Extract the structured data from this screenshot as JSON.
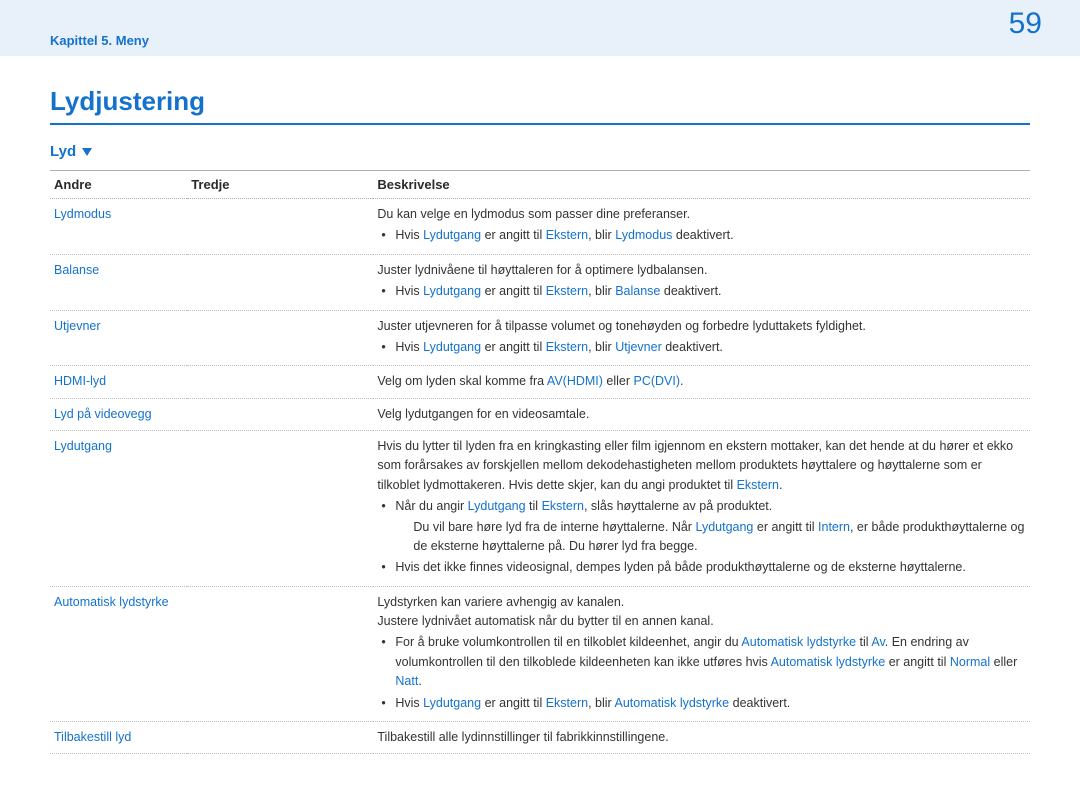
{
  "header": {
    "chapter": "Kapittel 5. Meny",
    "page": "59"
  },
  "title": "Lydjustering",
  "section": "Lyd",
  "table": {
    "headers": {
      "c1": "Andre",
      "c2": "Tredje",
      "c3": "Beskrivelse"
    }
  },
  "rows": {
    "lydmodus": {
      "label": "Lydmodus",
      "desc": "Du kan velge en lydmodus som passer dine preferanser.",
      "b1_p1": "Hvis ",
      "b1_h1": "Lydutgang",
      "b1_p2": " er angitt til ",
      "b1_h2": "Ekstern",
      "b1_p3": ", blir ",
      "b1_h3": "Lydmodus",
      "b1_p4": " deaktivert."
    },
    "balanse": {
      "label": "Balanse",
      "desc": "Juster lydnivåene til høyttaleren for å optimere lydbalansen.",
      "b1_p1": "Hvis ",
      "b1_h1": "Lydutgang",
      "b1_p2": " er angitt til ",
      "b1_h2": "Ekstern",
      "b1_p3": ", blir ",
      "b1_h3": "Balanse",
      "b1_p4": " deaktivert."
    },
    "utjevner": {
      "label": "Utjevner",
      "desc": "Juster utjevneren for å tilpasse volumet og tonehøyden og forbedre lyduttakets fyldighet.",
      "b1_p1": "Hvis ",
      "b1_h1": "Lydutgang",
      "b1_p2": " er angitt til ",
      "b1_h2": "Ekstern",
      "b1_p3": ", blir ",
      "b1_h3": "Utjevner",
      "b1_p4": " deaktivert."
    },
    "hdmilyd": {
      "label": "HDMI-lyd",
      "d_p1": "Velg om lyden skal komme fra ",
      "d_h1": "AV(HDMI)",
      "d_p2": " eller ",
      "d_h2": "PC(DVI)",
      "d_p3": "."
    },
    "videovegg": {
      "label": "Lyd på videovegg",
      "desc": "Velg lydutgangen for en videosamtale."
    },
    "lydutgang": {
      "label": "Lydutgang",
      "d_p1": "Hvis du lytter til lyden fra en kringkasting eller film igjennom en ekstern mottaker, kan det hende at du hører et ekko som forårsakes av forskjellen mellom dekodehastigheten mellom produktets høyttalere og høyttalerne som er tilkoblet lydmottakeren. Hvis dette skjer, kan du angi produktet til ",
      "d_h1": "Ekstern",
      "d_p2": ".",
      "b1_p1": "Når du angir ",
      "b1_h1": "Lydutgang",
      "b1_p2": " til ",
      "b1_h2": "Ekstern",
      "b1_p3": ", slås høyttalerne av på produktet.",
      "note_p1": "Du vil bare høre lyd fra de interne høyttalerne. Når ",
      "note_h1": "Lydutgang",
      "note_p2": " er angitt til ",
      "note_h2": "Intern",
      "note_p3": ", er både produkthøyttalerne og de eksterne høyttalerne på. Du hører lyd fra begge.",
      "b2": "Hvis det ikke finnes videosignal, dempes lyden på både produkthøyttalerne og de eksterne høyttalerne."
    },
    "autolyd": {
      "label": "Automatisk lydstyrke",
      "desc1": "Lydstyrken kan variere avhengig av kanalen.",
      "desc2": "Justere lydnivået automatisk når du bytter til en annen kanal.",
      "b1_p1": "For å bruke volumkontrollen til en tilkoblet kildeenhet, angir du ",
      "b1_h1": "Automatisk lydstyrke",
      "b1_p2": " til ",
      "b1_h2": "Av",
      "b1_p3": ". En endring av volumkontrollen til den tilkoblede kildeenheten kan ikke utføres hvis ",
      "b1_h3": "Automatisk lydstyrke",
      "b1_p4": " er angitt til ",
      "b1_h4": "Normal",
      "b1_p5": " eller ",
      "b1_h5": "Natt",
      "b1_p6": ".",
      "b2_p1": "Hvis ",
      "b2_h1": "Lydutgang",
      "b2_p2": " er angitt til ",
      "b2_h2": "Ekstern",
      "b2_p3": ", blir ",
      "b2_h3": "Automatisk lydstyrke",
      "b2_p4": " deaktivert."
    },
    "tilbake": {
      "label": "Tilbakestill lyd",
      "desc": "Tilbakestill alle lydinnstillinger til fabrikkinnstillingene."
    }
  }
}
